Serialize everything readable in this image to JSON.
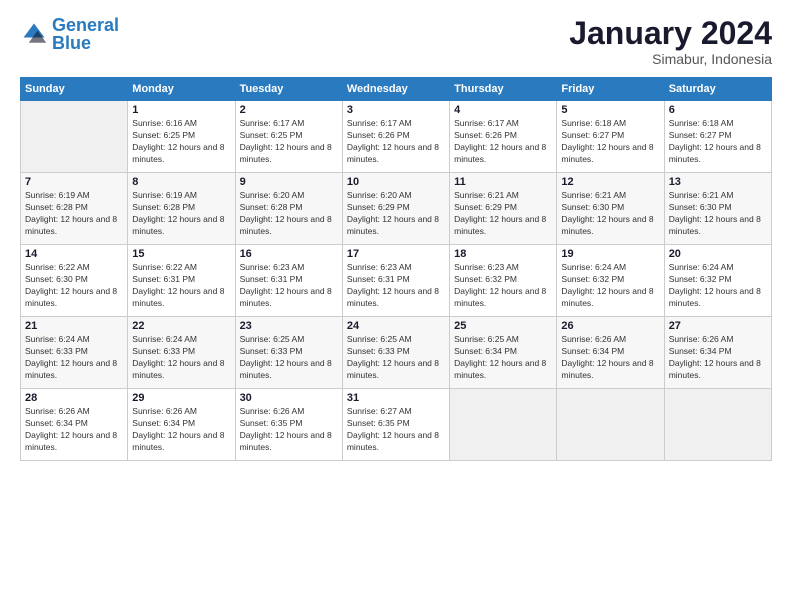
{
  "logo": {
    "text_general": "General",
    "text_blue": "Blue"
  },
  "header": {
    "month_year": "January 2024",
    "location": "Simabur, Indonesia"
  },
  "days_of_week": [
    "Sunday",
    "Monday",
    "Tuesday",
    "Wednesday",
    "Thursday",
    "Friday",
    "Saturday"
  ],
  "weeks": [
    [
      {
        "num": "",
        "empty": true
      },
      {
        "num": "1",
        "sunrise": "6:16 AM",
        "sunset": "6:25 PM",
        "daylight": "12 hours and 8 minutes."
      },
      {
        "num": "2",
        "sunrise": "6:17 AM",
        "sunset": "6:25 PM",
        "daylight": "12 hours and 8 minutes."
      },
      {
        "num": "3",
        "sunrise": "6:17 AM",
        "sunset": "6:26 PM",
        "daylight": "12 hours and 8 minutes."
      },
      {
        "num": "4",
        "sunrise": "6:17 AM",
        "sunset": "6:26 PM",
        "daylight": "12 hours and 8 minutes."
      },
      {
        "num": "5",
        "sunrise": "6:18 AM",
        "sunset": "6:27 PM",
        "daylight": "12 hours and 8 minutes."
      },
      {
        "num": "6",
        "sunrise": "6:18 AM",
        "sunset": "6:27 PM",
        "daylight": "12 hours and 8 minutes."
      }
    ],
    [
      {
        "num": "7",
        "sunrise": "6:19 AM",
        "sunset": "6:28 PM",
        "daylight": "12 hours and 8 minutes."
      },
      {
        "num": "8",
        "sunrise": "6:19 AM",
        "sunset": "6:28 PM",
        "daylight": "12 hours and 8 minutes."
      },
      {
        "num": "9",
        "sunrise": "6:20 AM",
        "sunset": "6:28 PM",
        "daylight": "12 hours and 8 minutes."
      },
      {
        "num": "10",
        "sunrise": "6:20 AM",
        "sunset": "6:29 PM",
        "daylight": "12 hours and 8 minutes."
      },
      {
        "num": "11",
        "sunrise": "6:21 AM",
        "sunset": "6:29 PM",
        "daylight": "12 hours and 8 minutes."
      },
      {
        "num": "12",
        "sunrise": "6:21 AM",
        "sunset": "6:30 PM",
        "daylight": "12 hours and 8 minutes."
      },
      {
        "num": "13",
        "sunrise": "6:21 AM",
        "sunset": "6:30 PM",
        "daylight": "12 hours and 8 minutes."
      }
    ],
    [
      {
        "num": "14",
        "sunrise": "6:22 AM",
        "sunset": "6:30 PM",
        "daylight": "12 hours and 8 minutes."
      },
      {
        "num": "15",
        "sunrise": "6:22 AM",
        "sunset": "6:31 PM",
        "daylight": "12 hours and 8 minutes."
      },
      {
        "num": "16",
        "sunrise": "6:23 AM",
        "sunset": "6:31 PM",
        "daylight": "12 hours and 8 minutes."
      },
      {
        "num": "17",
        "sunrise": "6:23 AM",
        "sunset": "6:31 PM",
        "daylight": "12 hours and 8 minutes."
      },
      {
        "num": "18",
        "sunrise": "6:23 AM",
        "sunset": "6:32 PM",
        "daylight": "12 hours and 8 minutes."
      },
      {
        "num": "19",
        "sunrise": "6:24 AM",
        "sunset": "6:32 PM",
        "daylight": "12 hours and 8 minutes."
      },
      {
        "num": "20",
        "sunrise": "6:24 AM",
        "sunset": "6:32 PM",
        "daylight": "12 hours and 8 minutes."
      }
    ],
    [
      {
        "num": "21",
        "sunrise": "6:24 AM",
        "sunset": "6:33 PM",
        "daylight": "12 hours and 8 minutes."
      },
      {
        "num": "22",
        "sunrise": "6:24 AM",
        "sunset": "6:33 PM",
        "daylight": "12 hours and 8 minutes."
      },
      {
        "num": "23",
        "sunrise": "6:25 AM",
        "sunset": "6:33 PM",
        "daylight": "12 hours and 8 minutes."
      },
      {
        "num": "24",
        "sunrise": "6:25 AM",
        "sunset": "6:33 PM",
        "daylight": "12 hours and 8 minutes."
      },
      {
        "num": "25",
        "sunrise": "6:25 AM",
        "sunset": "6:34 PM",
        "daylight": "12 hours and 8 minutes."
      },
      {
        "num": "26",
        "sunrise": "6:26 AM",
        "sunset": "6:34 PM",
        "daylight": "12 hours and 8 minutes."
      },
      {
        "num": "27",
        "sunrise": "6:26 AM",
        "sunset": "6:34 PM",
        "daylight": "12 hours and 8 minutes."
      }
    ],
    [
      {
        "num": "28",
        "sunrise": "6:26 AM",
        "sunset": "6:34 PM",
        "daylight": "12 hours and 8 minutes."
      },
      {
        "num": "29",
        "sunrise": "6:26 AM",
        "sunset": "6:34 PM",
        "daylight": "12 hours and 8 minutes."
      },
      {
        "num": "30",
        "sunrise": "6:26 AM",
        "sunset": "6:35 PM",
        "daylight": "12 hours and 8 minutes."
      },
      {
        "num": "31",
        "sunrise": "6:27 AM",
        "sunset": "6:35 PM",
        "daylight": "12 hours and 8 minutes."
      },
      {
        "num": "",
        "empty": true
      },
      {
        "num": "",
        "empty": true
      },
      {
        "num": "",
        "empty": true
      }
    ]
  ],
  "labels": {
    "sunrise": "Sunrise:",
    "sunset": "Sunset:",
    "daylight": "Daylight:"
  }
}
